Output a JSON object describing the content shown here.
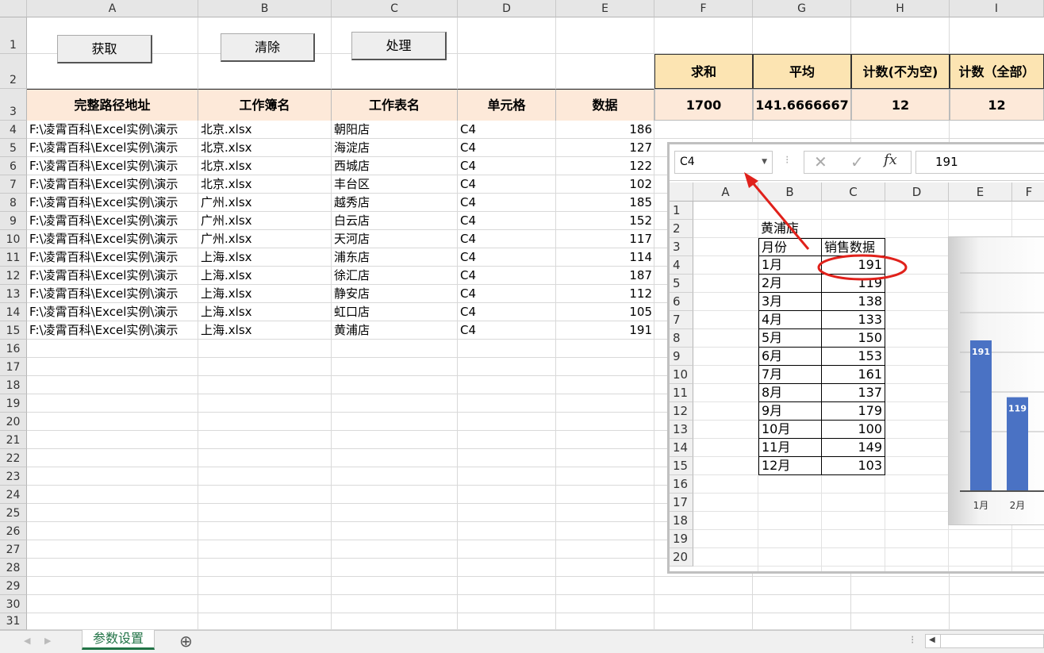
{
  "columns": [
    "A",
    "B",
    "C",
    "D",
    "E",
    "F",
    "G",
    "H",
    "I"
  ],
  "rows": [
    "1",
    "2",
    "3",
    "4",
    "5",
    "6",
    "7",
    "8",
    "9",
    "10",
    "11",
    "12",
    "13",
    "14",
    "15",
    "16",
    "17",
    "18",
    "19",
    "20",
    "21",
    "22",
    "23",
    "24",
    "25",
    "26",
    "27",
    "28",
    "29",
    "30",
    "31"
  ],
  "buttons": {
    "get": "获取",
    "clear": "清除",
    "process": "处理"
  },
  "summary": {
    "labels": [
      "求和",
      "平均",
      "计数(不为空)",
      "计数（全部）"
    ],
    "values": [
      "1700",
      "141.6666667",
      "12",
      "12"
    ]
  },
  "table_headers": [
    "完整路径地址",
    "工作簿名",
    "工作表名",
    "单元格",
    "数据"
  ],
  "table_rows": [
    {
      "path": "F:\\凌霄百科\\Excel实例\\演示",
      "book": "北京.xlsx",
      "sheet": "朝阳店",
      "cell": "C4",
      "value": "186"
    },
    {
      "path": "F:\\凌霄百科\\Excel实例\\演示",
      "book": "北京.xlsx",
      "sheet": "海淀店",
      "cell": "C4",
      "value": "127"
    },
    {
      "path": "F:\\凌霄百科\\Excel实例\\演示",
      "book": "北京.xlsx",
      "sheet": "西城店",
      "cell": "C4",
      "value": "122"
    },
    {
      "path": "F:\\凌霄百科\\Excel实例\\演示",
      "book": "北京.xlsx",
      "sheet": "丰台区",
      "cell": "C4",
      "value": "102"
    },
    {
      "path": "F:\\凌霄百科\\Excel实例\\演示",
      "book": "广州.xlsx",
      "sheet": "越秀店",
      "cell": "C4",
      "value": "185"
    },
    {
      "path": "F:\\凌霄百科\\Excel实例\\演示",
      "book": "广州.xlsx",
      "sheet": "白云店",
      "cell": "C4",
      "value": "152"
    },
    {
      "path": "F:\\凌霄百科\\Excel实例\\演示",
      "book": "广州.xlsx",
      "sheet": "天河店",
      "cell": "C4",
      "value": "117"
    },
    {
      "path": "F:\\凌霄百科\\Excel实例\\演示",
      "book": "上海.xlsx",
      "sheet": "浦东店",
      "cell": "C4",
      "value": "114"
    },
    {
      "path": "F:\\凌霄百科\\Excel实例\\演示",
      "book": "上海.xlsx",
      "sheet": "徐汇店",
      "cell": "C4",
      "value": "187"
    },
    {
      "path": "F:\\凌霄百科\\Excel实例\\演示",
      "book": "上海.xlsx",
      "sheet": "静安店",
      "cell": "C4",
      "value": "112"
    },
    {
      "path": "F:\\凌霄百科\\Excel实例\\演示",
      "book": "上海.xlsx",
      "sheet": "虹口店",
      "cell": "C4",
      "value": "105"
    },
    {
      "path": "F:\\凌霄百科\\Excel实例\\演示",
      "book": "上海.xlsx",
      "sheet": "黄浦店",
      "cell": "C4",
      "value": "191"
    }
  ],
  "sheet_tab": "参数设置",
  "add_sheet": "⊕",
  "inner": {
    "name_box": "C4",
    "formula_value": "191",
    "fx": "fx",
    "cancel": "✕",
    "confirm": "✓",
    "columns": [
      "A",
      "B",
      "C",
      "D",
      "E",
      "F"
    ],
    "rows": [
      "1",
      "2",
      "3",
      "4",
      "5",
      "6",
      "7",
      "8",
      "9",
      "10",
      "11",
      "12",
      "13",
      "14",
      "15",
      "16",
      "17",
      "18",
      "19",
      "20"
    ],
    "store_title": "黄浦店",
    "col_month": "月份",
    "col_sales": "销售数据",
    "months": [
      "1月",
      "2月",
      "3月",
      "4月",
      "5月",
      "6月",
      "7月",
      "8月",
      "9月",
      "10月",
      "11月",
      "12月"
    ],
    "sales": [
      "191",
      "119",
      "138",
      "133",
      "150",
      "153",
      "161",
      "137",
      "179",
      "100",
      "149",
      "103"
    ],
    "chart": {
      "bar_labels": [
        "191",
        "119"
      ],
      "x_labels": [
        "1月",
        "2月"
      ]
    }
  },
  "chart_data": {
    "type": "bar",
    "categories": [
      "1月",
      "2月"
    ],
    "values": [
      191,
      119
    ]
  }
}
